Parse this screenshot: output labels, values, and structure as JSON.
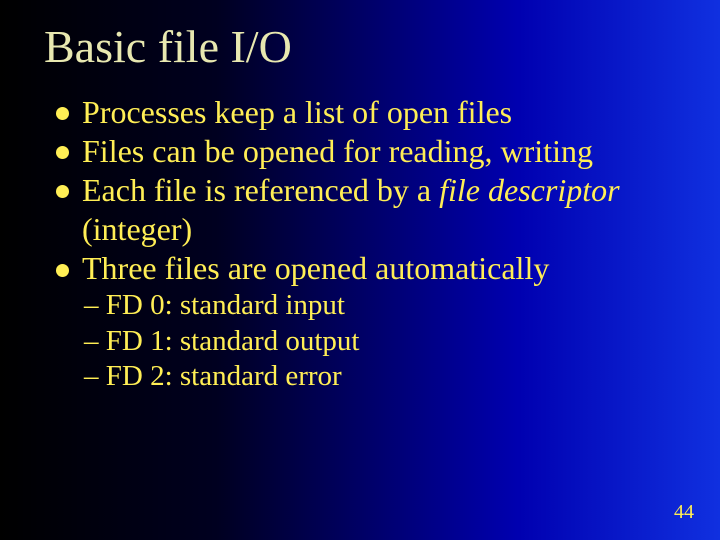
{
  "title": "Basic file I/O",
  "bullets": [
    {
      "pre": "Processes keep a list of open files"
    },
    {
      "pre": "Files can be opened for reading, writing"
    },
    {
      "pre": "Each file is referenced by a ",
      "em": "file descriptor",
      "post": " (integer)"
    },
    {
      "pre": "Three files are opened automatically"
    }
  ],
  "subs": [
    "– FD 0: standard input",
    "– FD 1: standard output",
    "– FD 2: standard error"
  ],
  "page": "44"
}
